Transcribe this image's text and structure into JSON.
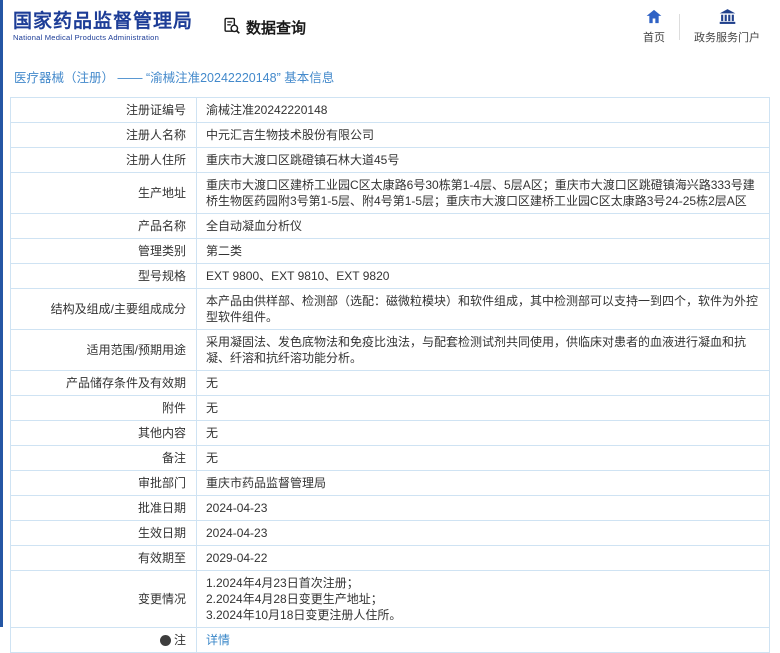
{
  "colors": {
    "brand_blue": "#1d3d97",
    "link_blue": "#3a87c8",
    "table_border": "#cfe3f3",
    "accent_bar": "#2456a4"
  },
  "header": {
    "logo_title": "国家药品监督管理局",
    "logo_subtitle": "National Medical Products Administration",
    "section_title": "数据查询",
    "nav": [
      {
        "label": "首页",
        "icon": "home-icon"
      },
      {
        "label": "政务服务门户",
        "icon": "government-portal-icon"
      }
    ]
  },
  "breadcrumb": "医疗器械（注册） ——  “渝械注准20242220148”  基本信息",
  "table": {
    "rows": [
      {
        "label": "注册证编号",
        "value": "渝械注准20242220148"
      },
      {
        "label": "注册人名称",
        "value": "中元汇吉生物技术股份有限公司"
      },
      {
        "label": "注册人住所",
        "value": "重庆市大渡口区跳磴镇石林大道45号"
      },
      {
        "label": "生产地址",
        "value": "重庆市大渡口区建桥工业园C区太康路6号30栋第1-4层、5层A区；重庆市大渡口区跳磴镇海兴路333号建桥生物医药园附3号第1-5层、附4号第1-5层；重庆市大渡口区建桥工业园C区太康路3号24-25栋2层A区"
      },
      {
        "label": "产品名称",
        "value": "全自动凝血分析仪"
      },
      {
        "label": "管理类别",
        "value": "第二类"
      },
      {
        "label": "型号规格",
        "value": "EXT 9800、EXT 9810、EXT 9820"
      },
      {
        "label": "结构及组成/主要组成成分",
        "value": "本产品由供样部、检测部（选配：磁微粒模块）和软件组成，其中检测部可以支持一到四个，软件为外控型软件组件。"
      },
      {
        "label": "适用范围/预期用途",
        "value": "采用凝固法、发色底物法和免疫比浊法，与配套检测试剂共同使用，供临床对患者的血液进行凝血和抗凝、纤溶和抗纤溶功能分析。"
      },
      {
        "label": "产品储存条件及有效期",
        "value": "无"
      },
      {
        "label": "附件",
        "value": "无"
      },
      {
        "label": "其他内容",
        "value": "无"
      },
      {
        "label": "备注",
        "value": "无"
      },
      {
        "label": "审批部门",
        "value": "重庆市药品监督管理局"
      },
      {
        "label": "批准日期",
        "value": "2024-04-23"
      },
      {
        "label": "生效日期",
        "value": "2024-04-23"
      },
      {
        "label": "有效期至",
        "value": "2029-04-22"
      },
      {
        "label": "变更情况",
        "value": "1.2024年4月23日首次注册；\n2.2024年4月28日变更生产地址；\n3.2024年10月18日变更注册人住所。"
      },
      {
        "label": "注",
        "value": "详情",
        "icon": true,
        "link": true
      }
    ]
  }
}
